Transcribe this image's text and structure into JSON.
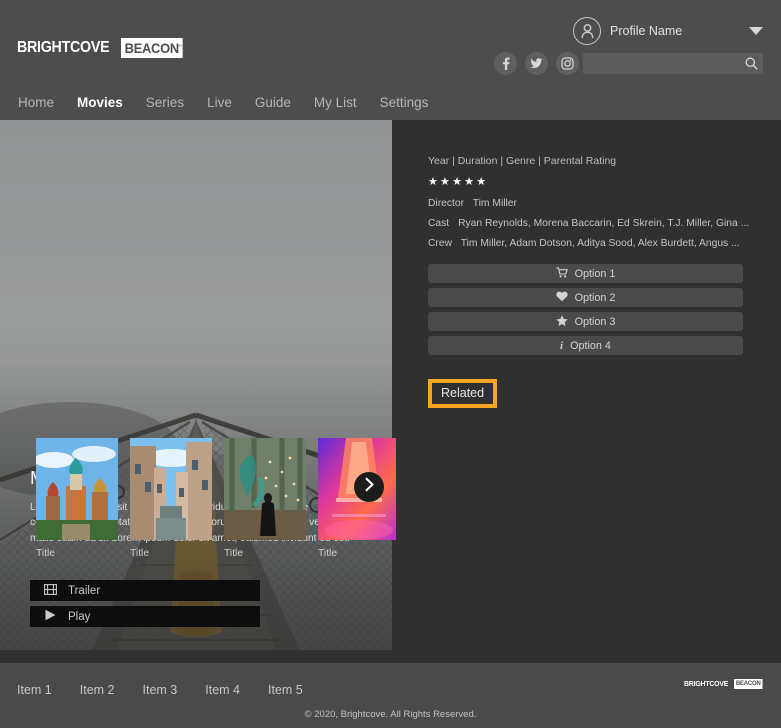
{
  "brand": {
    "logo_word": "BRIGHTCOVE",
    "logo_box": "BEACON",
    "trademark": "™"
  },
  "header": {
    "profile_name": "Profile Name",
    "profile_avatar_icon": "user-avatar-icon",
    "dropdown_icon": "chevron-down-icon",
    "social": [
      {
        "name": "facebook-icon",
        "glyph": "f"
      },
      {
        "name": "twitter-icon",
        "glyph": "t"
      },
      {
        "name": "instagram-icon",
        "glyph": "ig"
      }
    ],
    "search": {
      "value": "",
      "placeholder": "",
      "icon": "search-icon"
    },
    "nav": [
      {
        "label": "Home",
        "active": false
      },
      {
        "label": "Movies",
        "active": true
      },
      {
        "label": "Series",
        "active": false
      },
      {
        "label": "Live",
        "active": false
      },
      {
        "label": "Guide",
        "active": false
      },
      {
        "label": "My List",
        "active": false
      },
      {
        "label": "Settings",
        "active": false
      }
    ]
  },
  "hero": {
    "title": "Movie Title",
    "description": "Lorem ipsum dolor sit amet, euismod invidunt eu est. Ea case consequuntur voluptatibus vim, eius malorum euismod est et, vero malis etiam ea si. Lorem ipsum dolor sit amet, euismod invidunt eu est.",
    "buttons": [
      {
        "label": "Trailer",
        "icon": "film-strip-icon"
      },
      {
        "label": "Play",
        "icon": "play-triangle-icon"
      }
    ]
  },
  "detail": {
    "meta_line": "Year | Duration | Genre | Parental Rating",
    "rating_stars": 5,
    "credits": [
      {
        "label": "Director",
        "value": "Tim Miller"
      },
      {
        "label": "Cast",
        "value": "Ryan Reynolds, Morena Baccarin, Ed Skrein, T.J. Miller, Gina ..."
      },
      {
        "label": "Crew",
        "value": "Tim Miller, Adam Dotson, Aditya Sood, Alex Burdett, Angus ..."
      }
    ],
    "options": [
      {
        "label": "Option 1",
        "icon": "shopping-cart-icon"
      },
      {
        "label": "Option 2",
        "icon": "heart-icon"
      },
      {
        "label": "Option 3",
        "icon": "star-icon"
      },
      {
        "label": "Option 4",
        "icon": "info-icon"
      }
    ],
    "related": {
      "heading": "Related",
      "highlight_color": "#f5a623",
      "next_icon": "chevron-right-icon",
      "items": [
        {
          "title": "Title",
          "image": "cathedral-domes"
        },
        {
          "title": "Title",
          "image": "venice-canal"
        },
        {
          "title": "Title",
          "image": "forest-figure-teal-smoke"
        },
        {
          "title": "Title",
          "image": "neon-pink-corridor"
        }
      ]
    }
  },
  "footer": {
    "items": [
      "Item 1",
      "Item 2",
      "Item 3",
      "Item 4",
      "Item 5"
    ],
    "copyright": "© 2020, Brightcove. All Rights Reserved."
  }
}
